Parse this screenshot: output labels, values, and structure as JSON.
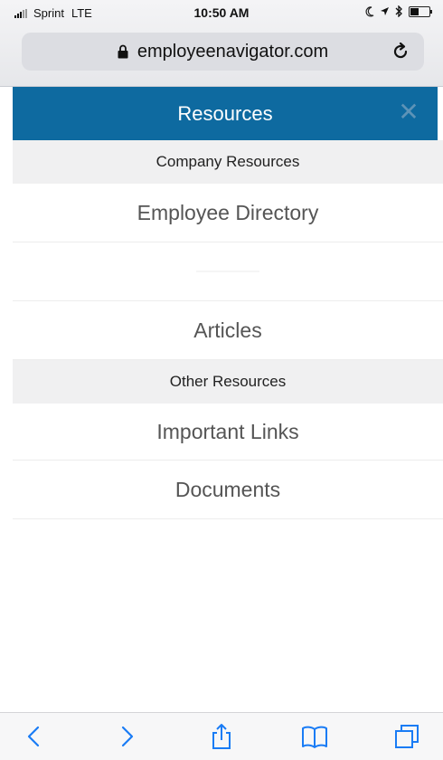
{
  "status_bar": {
    "carrier": "Sprint",
    "network": "LTE",
    "time": "10:50 AM"
  },
  "browser": {
    "url": "employeenavigator.com"
  },
  "header": {
    "title": "Resources",
    "close_icon": "close-icon"
  },
  "menu": {
    "sections": [
      {
        "title": "Company Resources",
        "items": [
          "Employee Directory",
          "",
          "Articles"
        ]
      },
      {
        "title": "Other Resources",
        "items": [
          "Important Links",
          "Documents"
        ]
      }
    ]
  },
  "toolbar": {
    "items": [
      "back-icon",
      "forward-icon",
      "share-icon",
      "bookmarks-icon",
      "tabs-icon"
    ]
  },
  "colors": {
    "header_bg": "#0e6aa0",
    "section_bg": "#f0f0f1",
    "item_text": "#555555"
  }
}
